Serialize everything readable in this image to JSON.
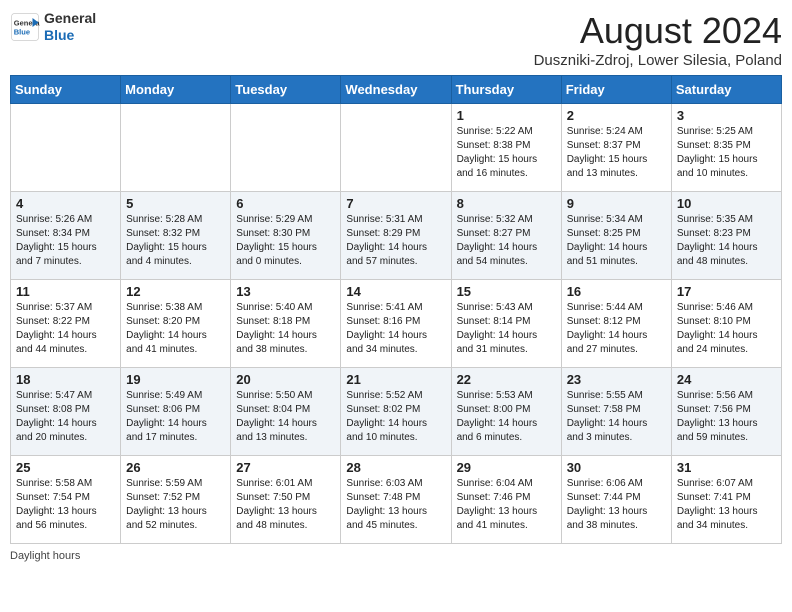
{
  "header": {
    "logo_general": "General",
    "logo_blue": "Blue",
    "month_year": "August 2024",
    "subtitle": "Duszniki-Zdroj, Lower Silesia, Poland"
  },
  "days_of_week": [
    "Sunday",
    "Monday",
    "Tuesday",
    "Wednesday",
    "Thursday",
    "Friday",
    "Saturday"
  ],
  "weeks": [
    [
      {
        "day": "",
        "info": ""
      },
      {
        "day": "",
        "info": ""
      },
      {
        "day": "",
        "info": ""
      },
      {
        "day": "",
        "info": ""
      },
      {
        "day": "1",
        "info": "Sunrise: 5:22 AM\nSunset: 8:38 PM\nDaylight: 15 hours and 16 minutes."
      },
      {
        "day": "2",
        "info": "Sunrise: 5:24 AM\nSunset: 8:37 PM\nDaylight: 15 hours and 13 minutes."
      },
      {
        "day": "3",
        "info": "Sunrise: 5:25 AM\nSunset: 8:35 PM\nDaylight: 15 hours and 10 minutes."
      }
    ],
    [
      {
        "day": "4",
        "info": "Sunrise: 5:26 AM\nSunset: 8:34 PM\nDaylight: 15 hours and 7 minutes."
      },
      {
        "day": "5",
        "info": "Sunrise: 5:28 AM\nSunset: 8:32 PM\nDaylight: 15 hours and 4 minutes."
      },
      {
        "day": "6",
        "info": "Sunrise: 5:29 AM\nSunset: 8:30 PM\nDaylight: 15 hours and 0 minutes."
      },
      {
        "day": "7",
        "info": "Sunrise: 5:31 AM\nSunset: 8:29 PM\nDaylight: 14 hours and 57 minutes."
      },
      {
        "day": "8",
        "info": "Sunrise: 5:32 AM\nSunset: 8:27 PM\nDaylight: 14 hours and 54 minutes."
      },
      {
        "day": "9",
        "info": "Sunrise: 5:34 AM\nSunset: 8:25 PM\nDaylight: 14 hours and 51 minutes."
      },
      {
        "day": "10",
        "info": "Sunrise: 5:35 AM\nSunset: 8:23 PM\nDaylight: 14 hours and 48 minutes."
      }
    ],
    [
      {
        "day": "11",
        "info": "Sunrise: 5:37 AM\nSunset: 8:22 PM\nDaylight: 14 hours and 44 minutes."
      },
      {
        "day": "12",
        "info": "Sunrise: 5:38 AM\nSunset: 8:20 PM\nDaylight: 14 hours and 41 minutes."
      },
      {
        "day": "13",
        "info": "Sunrise: 5:40 AM\nSunset: 8:18 PM\nDaylight: 14 hours and 38 minutes."
      },
      {
        "day": "14",
        "info": "Sunrise: 5:41 AM\nSunset: 8:16 PM\nDaylight: 14 hours and 34 minutes."
      },
      {
        "day": "15",
        "info": "Sunrise: 5:43 AM\nSunset: 8:14 PM\nDaylight: 14 hours and 31 minutes."
      },
      {
        "day": "16",
        "info": "Sunrise: 5:44 AM\nSunset: 8:12 PM\nDaylight: 14 hours and 27 minutes."
      },
      {
        "day": "17",
        "info": "Sunrise: 5:46 AM\nSunset: 8:10 PM\nDaylight: 14 hours and 24 minutes."
      }
    ],
    [
      {
        "day": "18",
        "info": "Sunrise: 5:47 AM\nSunset: 8:08 PM\nDaylight: 14 hours and 20 minutes."
      },
      {
        "day": "19",
        "info": "Sunrise: 5:49 AM\nSunset: 8:06 PM\nDaylight: 14 hours and 17 minutes."
      },
      {
        "day": "20",
        "info": "Sunrise: 5:50 AM\nSunset: 8:04 PM\nDaylight: 14 hours and 13 minutes."
      },
      {
        "day": "21",
        "info": "Sunrise: 5:52 AM\nSunset: 8:02 PM\nDaylight: 14 hours and 10 minutes."
      },
      {
        "day": "22",
        "info": "Sunrise: 5:53 AM\nSunset: 8:00 PM\nDaylight: 14 hours and 6 minutes."
      },
      {
        "day": "23",
        "info": "Sunrise: 5:55 AM\nSunset: 7:58 PM\nDaylight: 14 hours and 3 minutes."
      },
      {
        "day": "24",
        "info": "Sunrise: 5:56 AM\nSunset: 7:56 PM\nDaylight: 13 hours and 59 minutes."
      }
    ],
    [
      {
        "day": "25",
        "info": "Sunrise: 5:58 AM\nSunset: 7:54 PM\nDaylight: 13 hours and 56 minutes."
      },
      {
        "day": "26",
        "info": "Sunrise: 5:59 AM\nSunset: 7:52 PM\nDaylight: 13 hours and 52 minutes."
      },
      {
        "day": "27",
        "info": "Sunrise: 6:01 AM\nSunset: 7:50 PM\nDaylight: 13 hours and 48 minutes."
      },
      {
        "day": "28",
        "info": "Sunrise: 6:03 AM\nSunset: 7:48 PM\nDaylight: 13 hours and 45 minutes."
      },
      {
        "day": "29",
        "info": "Sunrise: 6:04 AM\nSunset: 7:46 PM\nDaylight: 13 hours and 41 minutes."
      },
      {
        "day": "30",
        "info": "Sunrise: 6:06 AM\nSunset: 7:44 PM\nDaylight: 13 hours and 38 minutes."
      },
      {
        "day": "31",
        "info": "Sunrise: 6:07 AM\nSunset: 7:41 PM\nDaylight: 13 hours and 34 minutes."
      }
    ]
  ],
  "footer": {
    "daylight_label": "Daylight hours"
  }
}
